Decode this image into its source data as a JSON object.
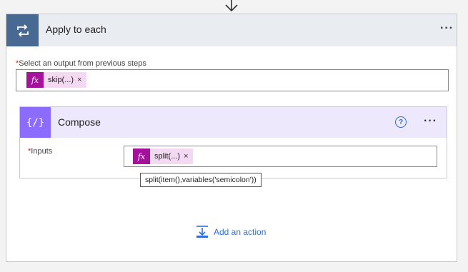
{
  "loop": {
    "title": "Apply to each",
    "more": "···",
    "output_label": "Select an output from previous steps",
    "required_mark": "*",
    "token": {
      "fx": "fx",
      "label": "skip(...)",
      "close": "×"
    }
  },
  "compose": {
    "title": "Compose",
    "help": "?",
    "more": "···",
    "inputs_label": "Inputs",
    "required_mark": "*",
    "token": {
      "fx": "fx",
      "label": "split(...)",
      "close": "×"
    }
  },
  "tooltip": {
    "text": "split(item(),variables('semicolon'))"
  },
  "add_action": {
    "label": "Add an action"
  },
  "icons": {
    "down_arrow": "arrow-down-icon",
    "loop": "loop-icon",
    "compose": "compose-icon",
    "help": "help-icon",
    "add_action": "add-action-icon"
  },
  "colors": {
    "loop_accent": "#486991",
    "compose_accent": "#8c6cff",
    "fx_token": "#a4129b",
    "link": "#2f6fd9",
    "required": "#c4262e"
  }
}
